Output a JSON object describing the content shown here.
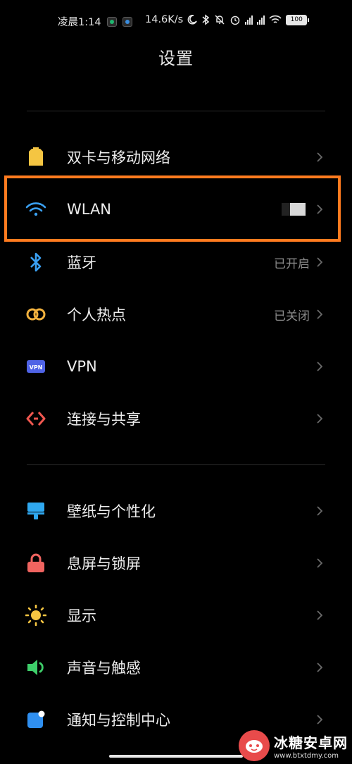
{
  "status_bar": {
    "time": "凌晨1:14",
    "net_speed": "14.6K/s",
    "battery": "100"
  },
  "title": "设置",
  "rows": [
    {
      "label": "双卡与移动网络",
      "value": "",
      "icon": "sim-card-icon",
      "color": "#f5c542"
    },
    {
      "label": "WLAN",
      "value": "",
      "icon": "wifi-icon",
      "color": "#3aa0f2"
    },
    {
      "label": "蓝牙",
      "value": "已开启",
      "icon": "bluetooth-icon",
      "color": "#3aa0f2"
    },
    {
      "label": "个人热点",
      "value": "已关闭",
      "icon": "hotspot-icon",
      "color": "#f2b23e"
    },
    {
      "label": "VPN",
      "value": "",
      "icon": "vpn-icon",
      "color": "#4f63e6"
    },
    {
      "label": "连接与共享",
      "value": "",
      "icon": "connection-share-icon",
      "color": "#f0574f"
    },
    {
      "label": "壁纸与个性化",
      "value": "",
      "icon": "wallpaper-icon",
      "color": "#2fa8f0"
    },
    {
      "label": "息屏与锁屏",
      "value": "",
      "icon": "lock-icon",
      "color": "#f06460"
    },
    {
      "label": "显示",
      "value": "",
      "icon": "sun-icon",
      "color": "#f5c542"
    },
    {
      "label": "声音与触感",
      "value": "",
      "icon": "speaker-icon",
      "color": "#3ecf6a"
    },
    {
      "label": "通知与控制中心",
      "value": "",
      "icon": "notification-icon",
      "color": "#2f8ff0"
    }
  ],
  "watermark": {
    "text": "冰糖安卓网",
    "url": "www.btxtdmy.com"
  }
}
